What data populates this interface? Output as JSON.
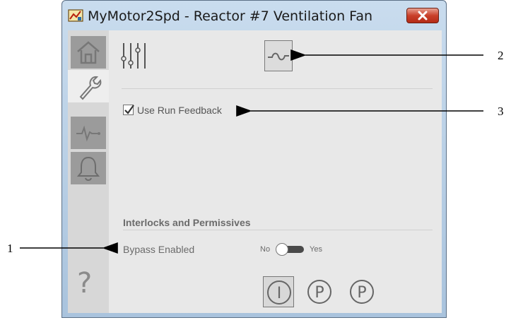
{
  "window": {
    "title": "MyMotor2Spd - Reactor #7 Ventilation Fan",
    "icon": "app-faceplate-icon"
  },
  "rail": {
    "items": [
      {
        "name": "home",
        "icon": "home-icon"
      },
      {
        "name": "maintenance",
        "icon": "wrench-icon",
        "active": true
      },
      {
        "name": "trends",
        "icon": "trend-icon"
      },
      {
        "name": "alarms",
        "icon": "bell-icon"
      }
    ],
    "help_glyph": "?"
  },
  "toolbar": {
    "left_icon": "sliders-icon",
    "right_icon": "bypass-icon"
  },
  "settings": {
    "use_run_feedback_label": "Use Run Feedback",
    "use_run_feedback_checked": true
  },
  "interlocks": {
    "section_title": "Interlocks and Permissives",
    "bypass_label": "Bypass Enabled",
    "toggle_off_label": "No",
    "toggle_on_label": "Yes",
    "bypass_enabled": false
  },
  "mode_buttons": [
    {
      "glyph": "I",
      "selected": true
    },
    {
      "glyph": "P",
      "selected": false
    },
    {
      "glyph": "P",
      "selected": false
    }
  ],
  "callouts": [
    {
      "number": "1"
    },
    {
      "number": "2"
    },
    {
      "number": "3"
    }
  ],
  "colors": {
    "title_bar": "#a9c3dd",
    "close_button": "#c9402a",
    "panel": "#e8e8e8",
    "rail_dark": "#9b9b9b"
  }
}
